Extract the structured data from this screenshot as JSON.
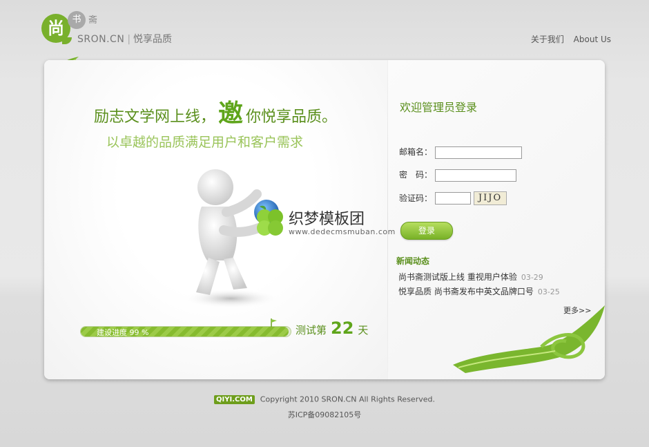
{
  "header": {
    "logo_char": "尚",
    "logo_small_char": "书",
    "logo_small_char2": "斋",
    "logo_brand": "SRON.CN",
    "logo_slogan": "悦享品质",
    "links": [
      "关于我们",
      "About Us"
    ]
  },
  "hero": {
    "headline_part1": "励志文学网上线，",
    "headline_emphasis": "邀",
    "headline_part2": "你悦享品质。",
    "subline": "以卓越的品质满足用户和客户需求"
  },
  "watermark": {
    "title": "织梦模板团",
    "url": "www.dedecmsmuban.com"
  },
  "progress": {
    "label": "建设进度 99 %",
    "fraction": 0.99,
    "day_prefix": "测试第",
    "day_number": "22",
    "day_suffix": "天"
  },
  "login": {
    "title": "欢迎管理员登录",
    "email_label": "邮箱名：",
    "password_label": "密　码：",
    "captcha_label": "验证码：",
    "captcha_text": "JIJO",
    "submit_label": "登录"
  },
  "news": {
    "title": "新闻动态",
    "items": [
      {
        "title": "尚书斋测试版上线 重视用户体验",
        "date": "03-29"
      },
      {
        "title": "悦享品质 尚书斋发布中英文品牌口号",
        "date": "03-25"
      }
    ],
    "more_label": "更多>>"
  },
  "footer": {
    "badge": "QIYI.COM",
    "copyright": "Copyright 2010 SRON.CN    All Rights Reserved.",
    "icp": "苏ICP备09082105号"
  },
  "colors": {
    "brand_green": "#79b02c",
    "text_green": "#5a8f1c"
  }
}
